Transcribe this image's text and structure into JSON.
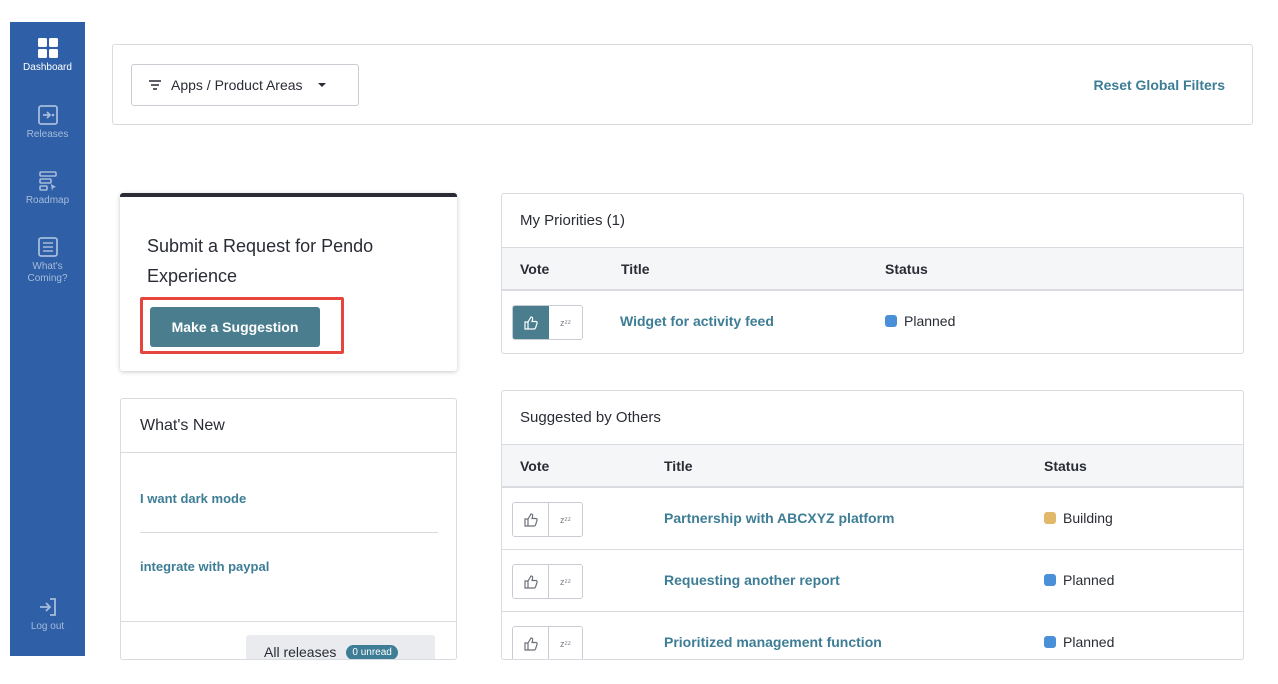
{
  "sidebar": {
    "items": [
      {
        "label": "Dashboard",
        "icon": "dashboard-icon"
      },
      {
        "label": "Releases",
        "icon": "releases-icon"
      },
      {
        "label": "Roadmap",
        "icon": "roadmap-icon"
      },
      {
        "label_line1": "What's",
        "label_line2": "Coming?",
        "icon": "whats-coming-icon"
      }
    ],
    "logout": {
      "label": "Log out",
      "icon": "logout-icon"
    }
  },
  "filter_bar": {
    "filter_label": "Apps / Product Areas",
    "reset_label": "Reset Global Filters"
  },
  "request_card": {
    "title": "Submit a Request for Pendo Experience",
    "button_label": "Make a Suggestion"
  },
  "whats_new": {
    "title": "What's New",
    "items": [
      "I want dark mode",
      "integrate with paypal"
    ],
    "all_releases_label": "All releases",
    "badge": "0 unread"
  },
  "my_priorities": {
    "title": "My Priorities (1)",
    "columns": [
      "Vote",
      "Title",
      "Status"
    ],
    "rows": [
      {
        "title": "Widget for activity feed",
        "status": "Planned",
        "status_color": "#4a90d9",
        "voted": true
      }
    ]
  },
  "suggested": {
    "title": "Suggested by Others",
    "columns": [
      "Vote",
      "Title",
      "Status"
    ],
    "rows": [
      {
        "title": "Partnership with ABCXYZ platform",
        "status": "Building",
        "status_color": "#e2b96a",
        "voted": false
      },
      {
        "title": "Requesting another report",
        "status": "Planned",
        "status_color": "#4a90d9",
        "voted": false
      },
      {
        "title": "Prioritized management function",
        "status": "Planned",
        "status_color": "#4a90d9",
        "voted": false
      }
    ]
  },
  "snooze_glyph": "zᶻᶻ",
  "colors": {
    "sidebar": "#2f5fa6",
    "accent": "#3d7d95",
    "button": "#4a7e8f",
    "highlight": "#e5453c"
  }
}
